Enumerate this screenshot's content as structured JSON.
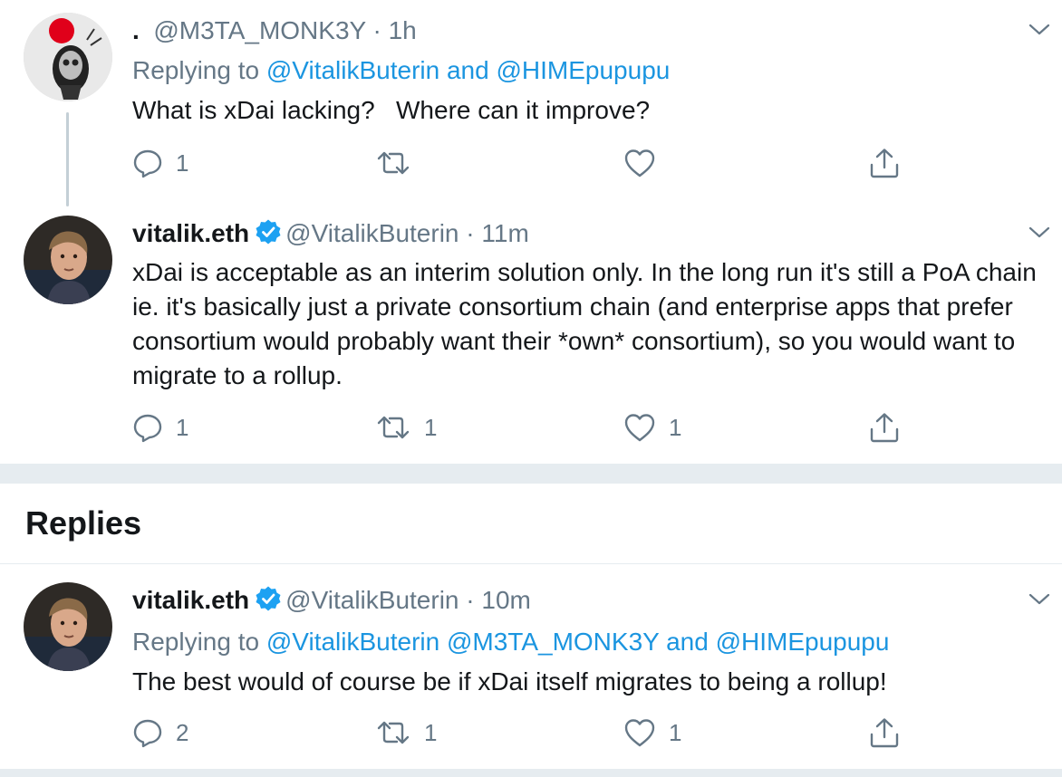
{
  "tweets": {
    "t1": {
      "display_name": ".",
      "handle": "@M3TA_MONK3Y",
      "time": "1h",
      "replying_label": "Replying to",
      "replying_links": "@VitalikButerin and @HIMEpupupu",
      "text": "What is xDai lacking?   Where can it improve?",
      "replies": "1",
      "retweets": "",
      "likes": ""
    },
    "t2": {
      "display_name": "vitalik.eth",
      "handle": "@VitalikButerin",
      "time": "11m",
      "text": "xDai is acceptable as an interim solution only. In the long run it's still a PoA chain ie. it's basically just a private consortium chain (and enterprise apps that prefer consortium would probably want their *own* consortium), so you would want to migrate to a rollup.",
      "replies": "1",
      "retweets": "1",
      "likes": "1"
    }
  },
  "replies_section": {
    "title": "Replies",
    "t3": {
      "display_name": "vitalik.eth",
      "handle": "@VitalikButerin",
      "time": "10m",
      "replying_label": "Replying to",
      "replying_links": "@VitalikButerin @M3TA_MONK3Y and @HIMEpupupu",
      "text": "The best would of course be if xDai itself migrates to being a rollup!",
      "replies": "2",
      "retweets": "1",
      "likes": "1"
    }
  },
  "colors": {
    "link": "#1b95e0",
    "muted": "#657786",
    "verified": "#1da1f2",
    "separator": "#e6ecf0"
  },
  "icons": [
    "chevron-down-icon",
    "reply-icon",
    "retweet-icon",
    "like-icon",
    "share-icon",
    "verified-icon"
  ]
}
